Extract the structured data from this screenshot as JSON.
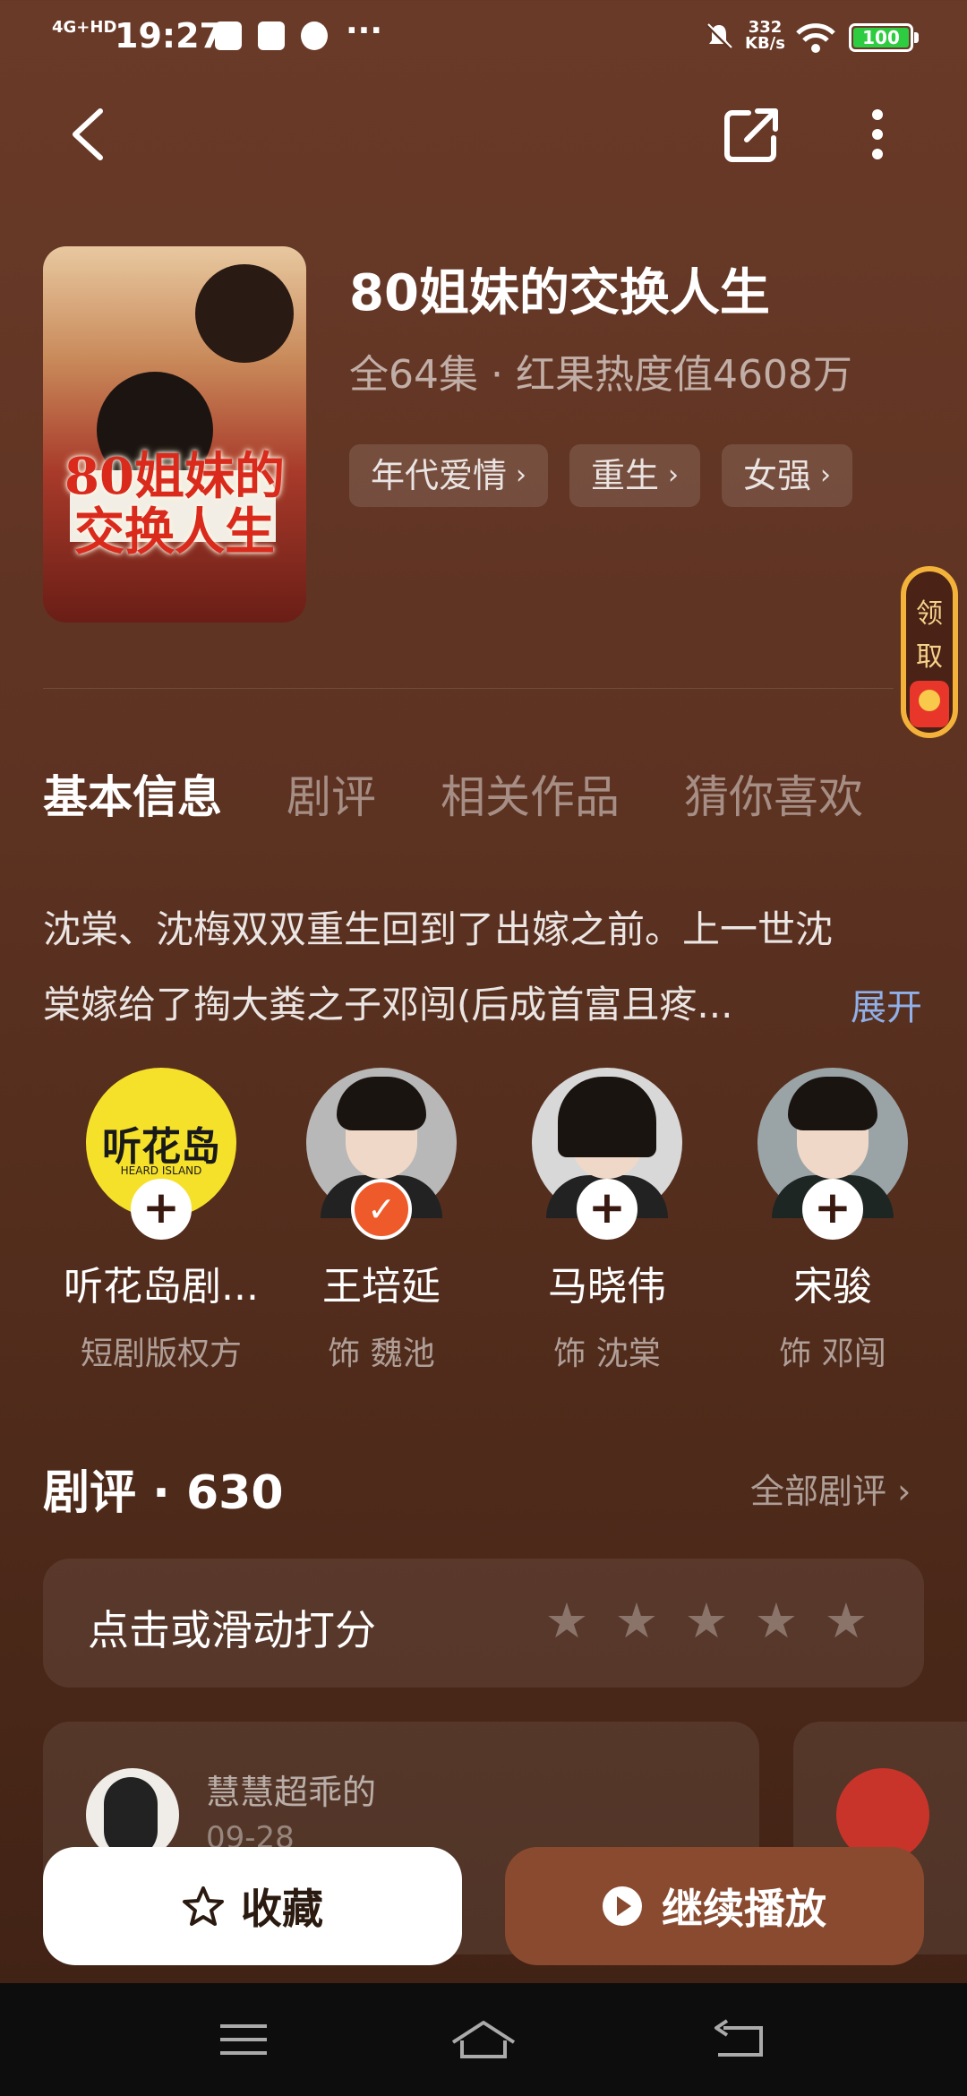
{
  "status_bar": {
    "network": "4G+HD",
    "time": "19:27",
    "more": "···",
    "speed_value": "332",
    "speed_unit": "KB/s",
    "battery": "100"
  },
  "drama": {
    "title": "80姐妹的交换人生",
    "meta": "全64集 · 红果热度值4608万",
    "poster_text": "80姐妹的交换人生",
    "tags": [
      {
        "label": "年代爱情"
      },
      {
        "label": "重生"
      },
      {
        "label": "女强"
      }
    ]
  },
  "reward": {
    "line1": "领",
    "line2": "取"
  },
  "tabs": [
    {
      "label": "基本信息"
    },
    {
      "label": "剧评"
    },
    {
      "label": "相关作品"
    },
    {
      "label": "猜你喜欢"
    }
  ],
  "synopsis": {
    "text": "沈棠、沈梅双双重生回到了出嫁之前。上一世沈棠嫁给了掏大粪之子邓闯(后成首富且疼...",
    "expand_label": "展开"
  },
  "cast": [
    {
      "name": "听花岛剧...",
      "role": "短剧版权方",
      "logo": "听花岛",
      "logo_sub": "HEARD ISLAND",
      "followed": false
    },
    {
      "name": "王培延",
      "role": "饰 魏池",
      "followed": true
    },
    {
      "name": "马晓伟",
      "role": "饰 沈棠",
      "followed": false
    },
    {
      "name": "宋骏",
      "role": "饰 邓闯",
      "followed": false
    }
  ],
  "reviews": {
    "heading": "剧评 · 630",
    "all_label": "全部剧评",
    "rate_prompt": "点击或滑动打分",
    "rating_filled": 0,
    "rating_max": 5,
    "items": [
      {
        "user": "慧慧超乖的",
        "date": "09-28"
      }
    ]
  },
  "actions": {
    "collect_label": "收藏",
    "play_label": "继续播放"
  },
  "colors": {
    "background": "#5e3322",
    "accent_link": "#8fb0e8",
    "follow_done": "#ef5a2a",
    "play_button": "#8a4a30"
  }
}
